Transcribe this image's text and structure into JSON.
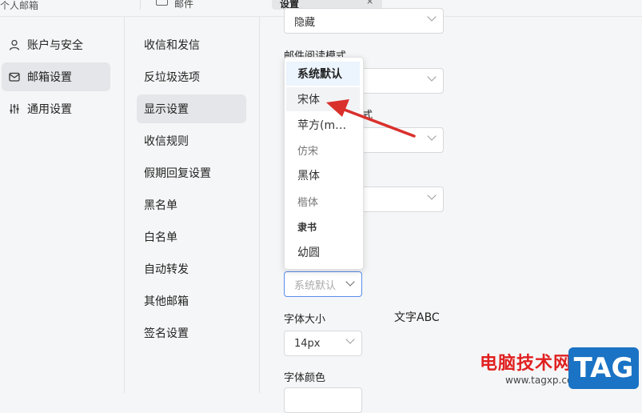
{
  "topbar": {
    "personal_mailbox": "个人邮箱",
    "tab_docs": "邮件",
    "tab_settings": "设置",
    "close": "×"
  },
  "leftnav": {
    "items": [
      {
        "label": "账户与安全",
        "icon": "user-icon"
      },
      {
        "label": "邮箱设置",
        "icon": "mailbox-icon",
        "active": true
      },
      {
        "label": "通用设置",
        "icon": "sliders-icon"
      }
    ]
  },
  "subnav": {
    "items": [
      {
        "label": "收信和发信"
      },
      {
        "label": "反垃圾选项"
      },
      {
        "label": "显示设置",
        "active": true
      },
      {
        "label": "收信规则"
      },
      {
        "label": "假期回复设置"
      },
      {
        "label": "黑名单"
      },
      {
        "label": "白名单"
      },
      {
        "label": "自动转发"
      },
      {
        "label": "其他邮箱"
      },
      {
        "label": "签名设置"
      }
    ]
  },
  "main": {
    "select_top_value": "隐藏",
    "reading_mode_label": "邮件阅读模式",
    "style_label_suffix": "式",
    "font_select_value": "系统默认",
    "font_size_label": "字体大小",
    "font_size_value": "14px",
    "preview_text": "文字ABC",
    "font_color_label": "字体颜色"
  },
  "font_dropdown": {
    "options": [
      "系统默认",
      "宋体",
      "苹方(m…",
      "仿宋",
      "黑体",
      "楷体",
      "隶书",
      "幼圆"
    ],
    "selected": "系统默认",
    "hovered": "宋体"
  },
  "annotation": {
    "arrow_color": "#d9302c"
  },
  "watermark": {
    "site_name": "电脑技术网",
    "url": "www.tagxp.com",
    "badge": "TAG"
  }
}
